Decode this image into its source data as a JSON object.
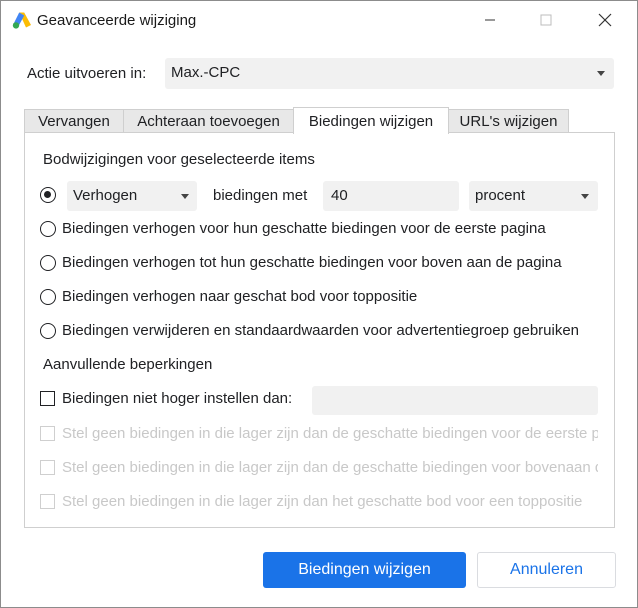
{
  "window": {
    "title": "Geavanceerde wijziging",
    "logo_icon": "google-ads-logo",
    "controls": [
      "minimize-icon",
      "maximize-icon",
      "close-icon"
    ]
  },
  "action": {
    "label": "Actie uitvoeren in:",
    "selected": "Max.-CPC"
  },
  "tabs": [
    {
      "label": "Vervangen",
      "active": false
    },
    {
      "label": "Achteraan toevoegen",
      "active": false
    },
    {
      "label": "Biedingen wijzigen",
      "active": true
    },
    {
      "label": "URL's wijzigen",
      "active": false
    }
  ],
  "panel": {
    "section_title": "Bodwijzigingen voor geselecteerde items",
    "option1": {
      "selected": true,
      "mode": "Verhogen",
      "middle_text": "biedingen met",
      "amount": "40",
      "unit": "procent"
    },
    "options": [
      {
        "label": "Biedingen verhogen voor hun geschatte biedingen voor de eerste pagina",
        "selected": false
      },
      {
        "label": "Biedingen verhogen tot hun geschatte biedingen voor boven aan de pagina",
        "selected": false
      },
      {
        "label": "Biedingen verhogen naar geschat bod voor toppositie",
        "selected": false
      },
      {
        "label": "Biedingen verwijderen en standaardwaarden voor advertentiegroep gebruiken",
        "selected": false
      }
    ],
    "constraints_title": "Aanvullende beperkingen",
    "max_bid": {
      "label": "Biedingen niet hoger instellen dan:",
      "checked": false,
      "value": ""
    },
    "disabled_options": [
      "Stel geen biedingen in die lager zijn dan de geschatte biedingen voor de eerste pa",
      "Stel geen biedingen in die lager zijn dan de geschatte biedingen voor bovenaan de",
      "Stel geen biedingen in die lager zijn dan het geschatte bod voor een toppositie"
    ]
  },
  "buttons": {
    "primary": "Biedingen wijzigen",
    "secondary": "Annuleren"
  },
  "colors": {
    "accent": "#1a73e8",
    "disabled_text": "#c8c8c8",
    "field_bg": "#f1f1f1"
  }
}
